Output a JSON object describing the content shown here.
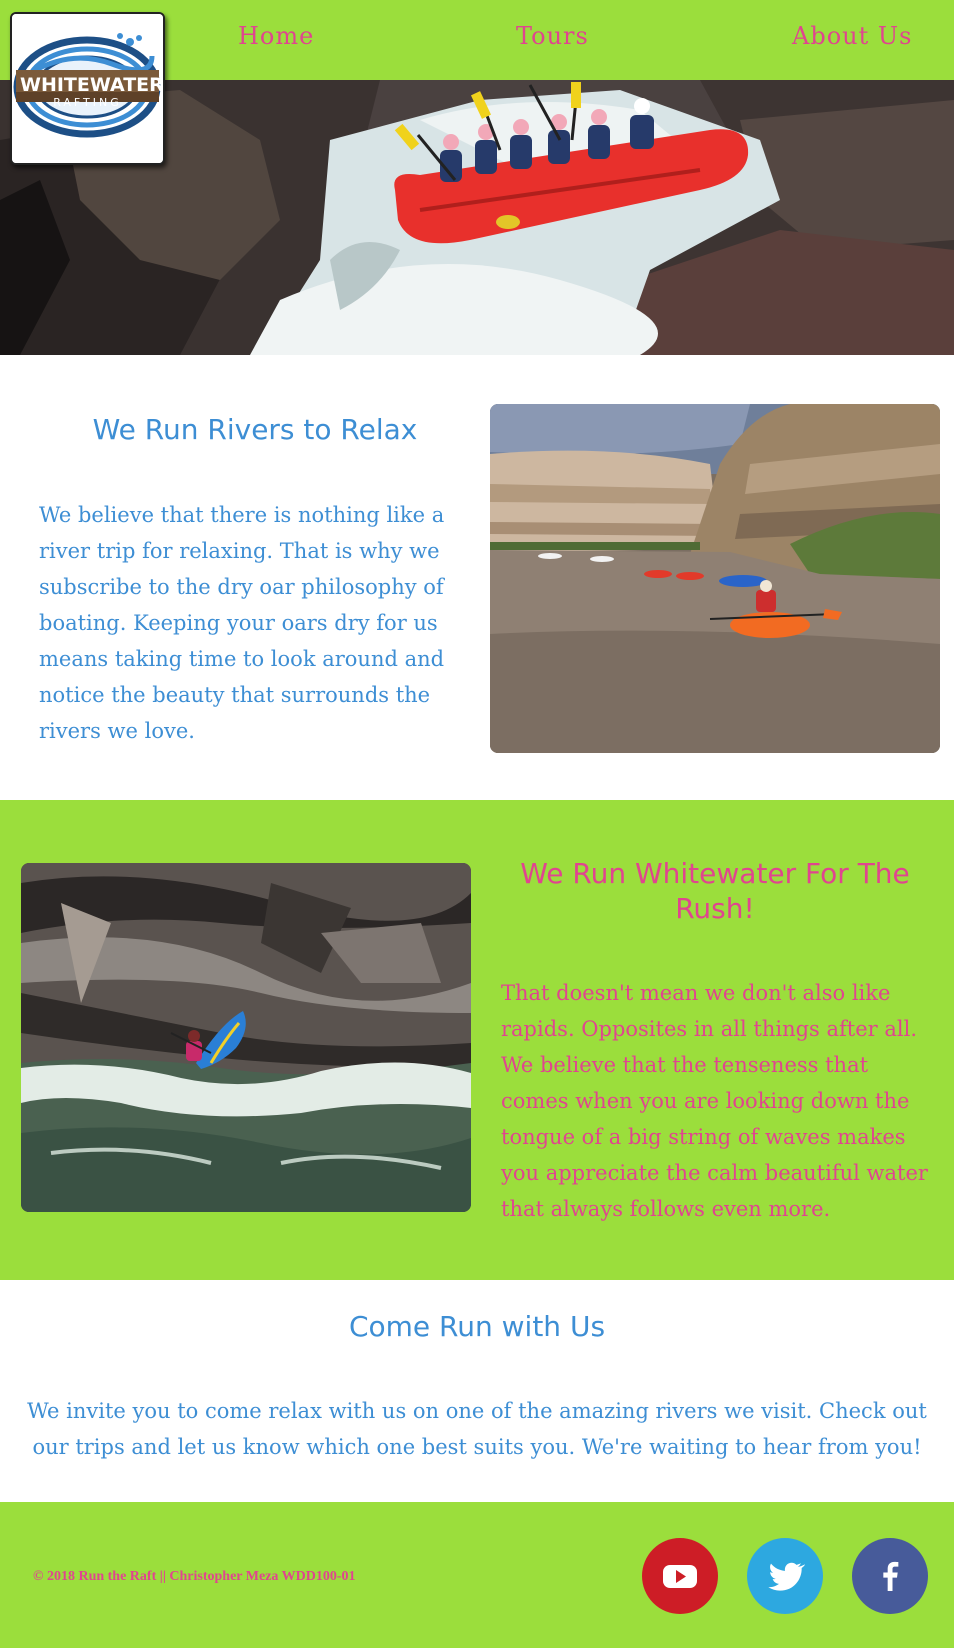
{
  "nav": {
    "home": "Home",
    "tours": "Tours",
    "about": "About Us"
  },
  "logo": {
    "line1": "WHITEWATER",
    "line2": "RAFTING"
  },
  "section_relax": {
    "title": "We Run Rivers to Relax",
    "body": "We believe that there is nothing like a river trip for relaxing. That is why we subscribe to the dry oar philosophy of boating. Keeping your oars dry for us means taking time to look around and notice the beauty that surrounds the rivers we love."
  },
  "section_rush": {
    "title": "We Run Whitewater For The Rush!",
    "body": "That doesn't mean we don't also like rapids. Opposites in all things after all. We believe that the tenseness that comes when you are looking down the tongue of a big string of waves makes you appreciate the calm beautiful water that always follows even more."
  },
  "section_join": {
    "title": "Come Run with Us",
    "body": "We invite you to come relax with us on one of the amazing rivers we visit. Check out our trips and let us know which one best suits you. We're waiting to hear from you!"
  },
  "footer": {
    "copyright": "© 2018 Run the Raft || Christopher Meza WDD100-01"
  },
  "social": {
    "youtube": "youtube-icon",
    "twitter": "twitter-icon",
    "facebook": "facebook-icon"
  },
  "colors": {
    "green": "#9bde3c",
    "pink": "#e0458f",
    "blue": "#3d8ed4"
  }
}
